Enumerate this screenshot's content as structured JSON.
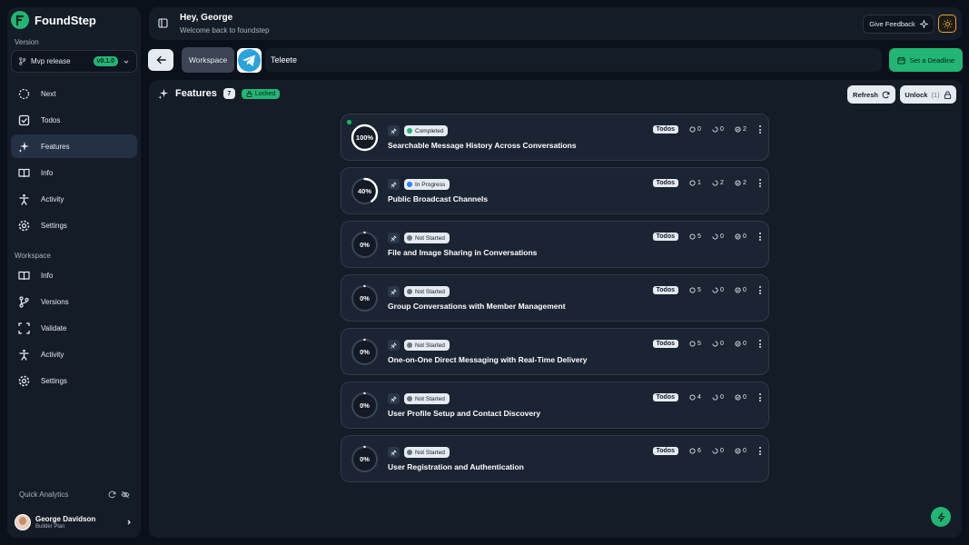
{
  "brand": {
    "name": "FoundStep"
  },
  "sidebar": {
    "version_label": "Version",
    "version_select": {
      "value": "Mvp release",
      "badge": "v0.1.0"
    },
    "items": [
      {
        "label": "Next",
        "icon": "loader-icon"
      },
      {
        "label": "Todos",
        "icon": "checkbox-icon"
      },
      {
        "label": "Features",
        "icon": "sparkles-icon",
        "active": true
      },
      {
        "label": "Info",
        "icon": "book-icon"
      },
      {
        "label": "Activity",
        "icon": "person-icon"
      },
      {
        "label": "Settings",
        "icon": "gear-icon"
      }
    ],
    "workspace_label": "Workspace",
    "workspace_items": [
      {
        "label": "Info",
        "icon": "book-icon"
      },
      {
        "label": "Versions",
        "icon": "git-branch-icon"
      },
      {
        "label": "Validate",
        "icon": "scan-icon"
      },
      {
        "label": "Activity",
        "icon": "person-icon"
      },
      {
        "label": "Settings",
        "icon": "gear-icon"
      }
    ],
    "quick_analytics": "Quick Analytics",
    "user": {
      "name": "George Davidson",
      "plan": "Builder Plan"
    }
  },
  "header": {
    "greeting": "Hey, George",
    "subtitle": "Welcome back to foundstep",
    "feedback_label": "Give Feedback"
  },
  "toolbar": {
    "workspace_label": "Workspace",
    "project_name": "Teleete",
    "deadline_label": "Set a Deadline"
  },
  "features_panel": {
    "title": "Features",
    "count": "7",
    "locked_label": "Locked",
    "refresh_label": "Refresh",
    "unlock_label": "Unlock",
    "unlock_count": "(1)"
  },
  "features": [
    {
      "title": "Searchable Message History Across Conversations",
      "status": "Completed",
      "progress": 100,
      "progress_label": "100%",
      "todos_label": "Todos",
      "stats": [
        "0",
        "0",
        "2"
      ],
      "highlight": true
    },
    {
      "title": "Public Broadcast Channels",
      "status": "In Progress",
      "progress": 40,
      "progress_label": "40%",
      "todos_label": "Todos",
      "stats": [
        "1",
        "2",
        "2"
      ]
    },
    {
      "title": "File and Image Sharing in Conversations",
      "status": "Not Started",
      "progress": 0,
      "progress_label": "0%",
      "todos_label": "Todos",
      "stats": [
        "5",
        "0",
        "0"
      ]
    },
    {
      "title": "Group Conversations with Member Management",
      "status": "Not Started",
      "progress": 0,
      "progress_label": "0%",
      "todos_label": "Todos",
      "stats": [
        "5",
        "0",
        "0"
      ]
    },
    {
      "title": "One-on-One Direct Messaging with Real-Time Delivery",
      "status": "Not Started",
      "progress": 0,
      "progress_label": "0%",
      "todos_label": "Todos",
      "stats": [
        "5",
        "0",
        "0"
      ]
    },
    {
      "title": "User Profile Setup and Contact Discovery",
      "status": "Not Started",
      "progress": 0,
      "progress_label": "0%",
      "todos_label": "Todos",
      "stats": [
        "4",
        "0",
        "0"
      ]
    },
    {
      "title": "User Registration and Authentication",
      "status": "Not Started",
      "progress": 0,
      "progress_label": "0%",
      "todos_label": "Todos",
      "stats": [
        "6",
        "0",
        "0"
      ]
    }
  ],
  "colors": {
    "accent": "#22b573",
    "status_completed": "#22b573",
    "status_in_progress": "#2f80ed",
    "status_not_started": "#6b7583"
  }
}
